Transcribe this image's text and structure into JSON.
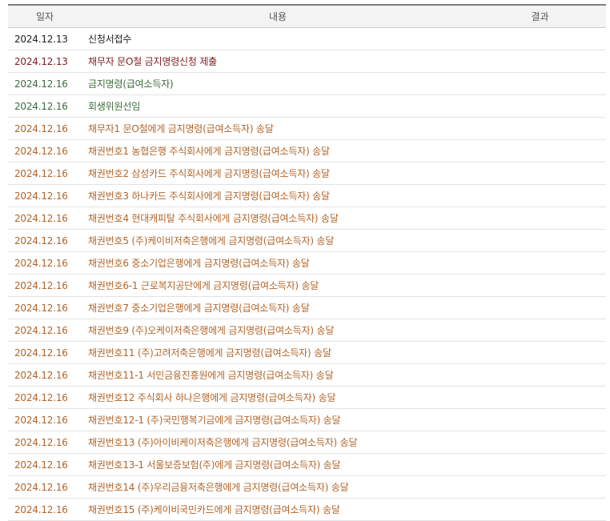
{
  "header": {
    "date": "일자",
    "content": "내용",
    "result": "결과"
  },
  "colors": {
    "black": "#222222",
    "maroon": "#7a1f1f",
    "green": "#3d6b3d",
    "orange": "#b0652a"
  },
  "rows": [
    {
      "date": "2024.12.13",
      "content": "신청서접수",
      "result": "",
      "tone": "black"
    },
    {
      "date": "2024.12.13",
      "content": "채무자 문O철 금지명령신청 제출",
      "result": "",
      "tone": "maroon"
    },
    {
      "date": "2024.12.16",
      "content": "금지명령(급여소득자)",
      "result": "",
      "tone": "green"
    },
    {
      "date": "2024.12.16",
      "content": "회생위원선임",
      "result": "",
      "tone": "green"
    },
    {
      "date": "2024.12.16",
      "content": "채무자1 문O철에게 금지명령(급여소득자) 송달",
      "result": "",
      "tone": "orange"
    },
    {
      "date": "2024.12.16",
      "content": "채권번호1 농협은행 주식회사에게 금지명령(급여소득자) 송달",
      "result": "",
      "tone": "orange"
    },
    {
      "date": "2024.12.16",
      "content": "채권번호2 삼성카드 주식회사에게 금지명령(급여소득자) 송달",
      "result": "",
      "tone": "orange"
    },
    {
      "date": "2024.12.16",
      "content": "채권번호3 하나카드 주식회사에게 금지명령(급여소득자) 송달",
      "result": "",
      "tone": "orange"
    },
    {
      "date": "2024.12.16",
      "content": "채권번호4 현대캐피탈 주식회사에게 금지명령(급여소득자) 송달",
      "result": "",
      "tone": "orange"
    },
    {
      "date": "2024.12.16",
      "content": "채권번호5 (주)케이비저축은행에게 금지명령(급여소득자) 송달",
      "result": "",
      "tone": "orange"
    },
    {
      "date": "2024.12.16",
      "content": "채권번호6 중소기업은행에게 금지명령(급여소득자) 송달",
      "result": "",
      "tone": "orange"
    },
    {
      "date": "2024.12.16",
      "content": "채권번호6-1 근로복지공단에게 금지명령(급여소득자) 송달",
      "result": "",
      "tone": "orange"
    },
    {
      "date": "2024.12.16",
      "content": "채권번호7 중소기업은행에게 금지명령(급여소득자) 송달",
      "result": "",
      "tone": "orange"
    },
    {
      "date": "2024.12.16",
      "content": "채권번호9 (주)오케이저축은행에게 금지명령(급여소득자) 송달",
      "result": "",
      "tone": "orange"
    },
    {
      "date": "2024.12.16",
      "content": "채권번호11 (주)고려저축은행에게 금지명령(급여소득자) 송달",
      "result": "",
      "tone": "orange"
    },
    {
      "date": "2024.12.16",
      "content": "채권번호11-1 서민금융진흥원에게 금지명령(급여소득자) 송달",
      "result": "",
      "tone": "orange"
    },
    {
      "date": "2024.12.16",
      "content": "채권번호12 주식회사 하나은행에게 금지명령(급여소득자) 송달",
      "result": "",
      "tone": "orange"
    },
    {
      "date": "2024.12.16",
      "content": "채권번호12-1 (주)국민행복기금에게 금지명령(급여소득자) 송달",
      "result": "",
      "tone": "orange"
    },
    {
      "date": "2024.12.16",
      "content": "채권번호13 (주)아이비케이저축은행에게 금지명령(급여소득자) 송달",
      "result": "",
      "tone": "orange"
    },
    {
      "date": "2024.12.16",
      "content": "채권번호13-1 서울보증보험(주)에게 금지명령(급여소득자) 송달",
      "result": "",
      "tone": "orange"
    },
    {
      "date": "2024.12.16",
      "content": "채권번호14 (주)우리금융저축은행에게 금지명령(급여소득자) 송달",
      "result": "",
      "tone": "orange"
    },
    {
      "date": "2024.12.16",
      "content": "채권번호15 (주)케이비국민카드에게 금지명령(급여소득자) 송달",
      "result": "",
      "tone": "orange"
    }
  ]
}
